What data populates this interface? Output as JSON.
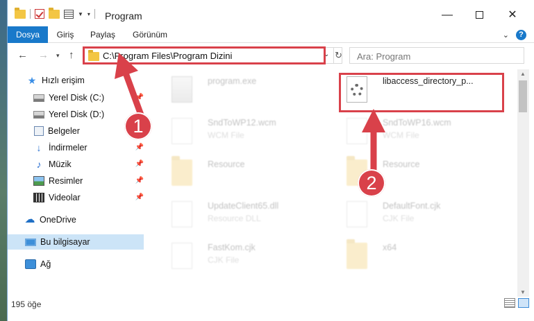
{
  "window": {
    "title": "Program",
    "controls": {
      "minimize": "—",
      "maximize": "",
      "close": "✕"
    }
  },
  "ribbon": {
    "tabs": [
      "Dosya",
      "Giriş",
      "Paylaş",
      "Görünüm"
    ],
    "help": "?"
  },
  "navigation": {
    "address": "C:\\Program Files\\Program Dizini",
    "search_placeholder": "Ara: Program"
  },
  "sidebar": {
    "items": [
      {
        "label": "Hızlı erişim",
        "icon": "star-icon"
      },
      {
        "label": "Yerel Disk (C:)",
        "icon": "drive-icon",
        "pinned": true
      },
      {
        "label": "Yerel Disk (D:)",
        "icon": "drive-icon",
        "pinned": true
      },
      {
        "label": "Belgeler",
        "icon": "documents-icon",
        "pinned": true
      },
      {
        "label": "İndirmeler",
        "icon": "download-icon",
        "pinned": true
      },
      {
        "label": "Müzik",
        "icon": "music-icon",
        "pinned": true
      },
      {
        "label": "Resimler",
        "icon": "pictures-icon",
        "pinned": true
      },
      {
        "label": "Videolar",
        "icon": "video-icon",
        "pinned": true
      },
      {
        "label": "OneDrive",
        "icon": "cloud-icon"
      },
      {
        "label": "Bu bilgisayar",
        "icon": "computer-icon",
        "selected": true
      },
      {
        "label": "Ağ",
        "icon": "network-icon"
      }
    ]
  },
  "files": [
    {
      "name": "program.exe",
      "type": "",
      "icon": "exe-icon"
    },
    {
      "name": "libaccess_directory_p...",
      "type": "",
      "icon": "settings-file-icon"
    },
    {
      "name": "SndToWP12.wcm",
      "type": "WCM File",
      "icon": "file-icon"
    },
    {
      "name": "SndToWP16.wcm",
      "type": "WCM File",
      "icon": "file-icon"
    },
    {
      "name": "Resource",
      "type": "",
      "icon": "folder-icon"
    },
    {
      "name": "Resource",
      "type": "",
      "icon": "folder-icon"
    },
    {
      "name": "UpdateClient65.dll",
      "type": "Resource DLL",
      "icon": "dll-icon"
    },
    {
      "name": "DefaultFont.cjk",
      "type": "CJK File",
      "icon": "file-icon"
    },
    {
      "name": "FastKom.cjk",
      "type": "CJK File",
      "icon": "file-icon"
    },
    {
      "name": "x64",
      "type": "",
      "icon": "folder-icon"
    }
  ],
  "status": {
    "count": "195 öğe"
  },
  "annotations": {
    "step1": "1",
    "step2": "2",
    "color": "#d9414a"
  }
}
